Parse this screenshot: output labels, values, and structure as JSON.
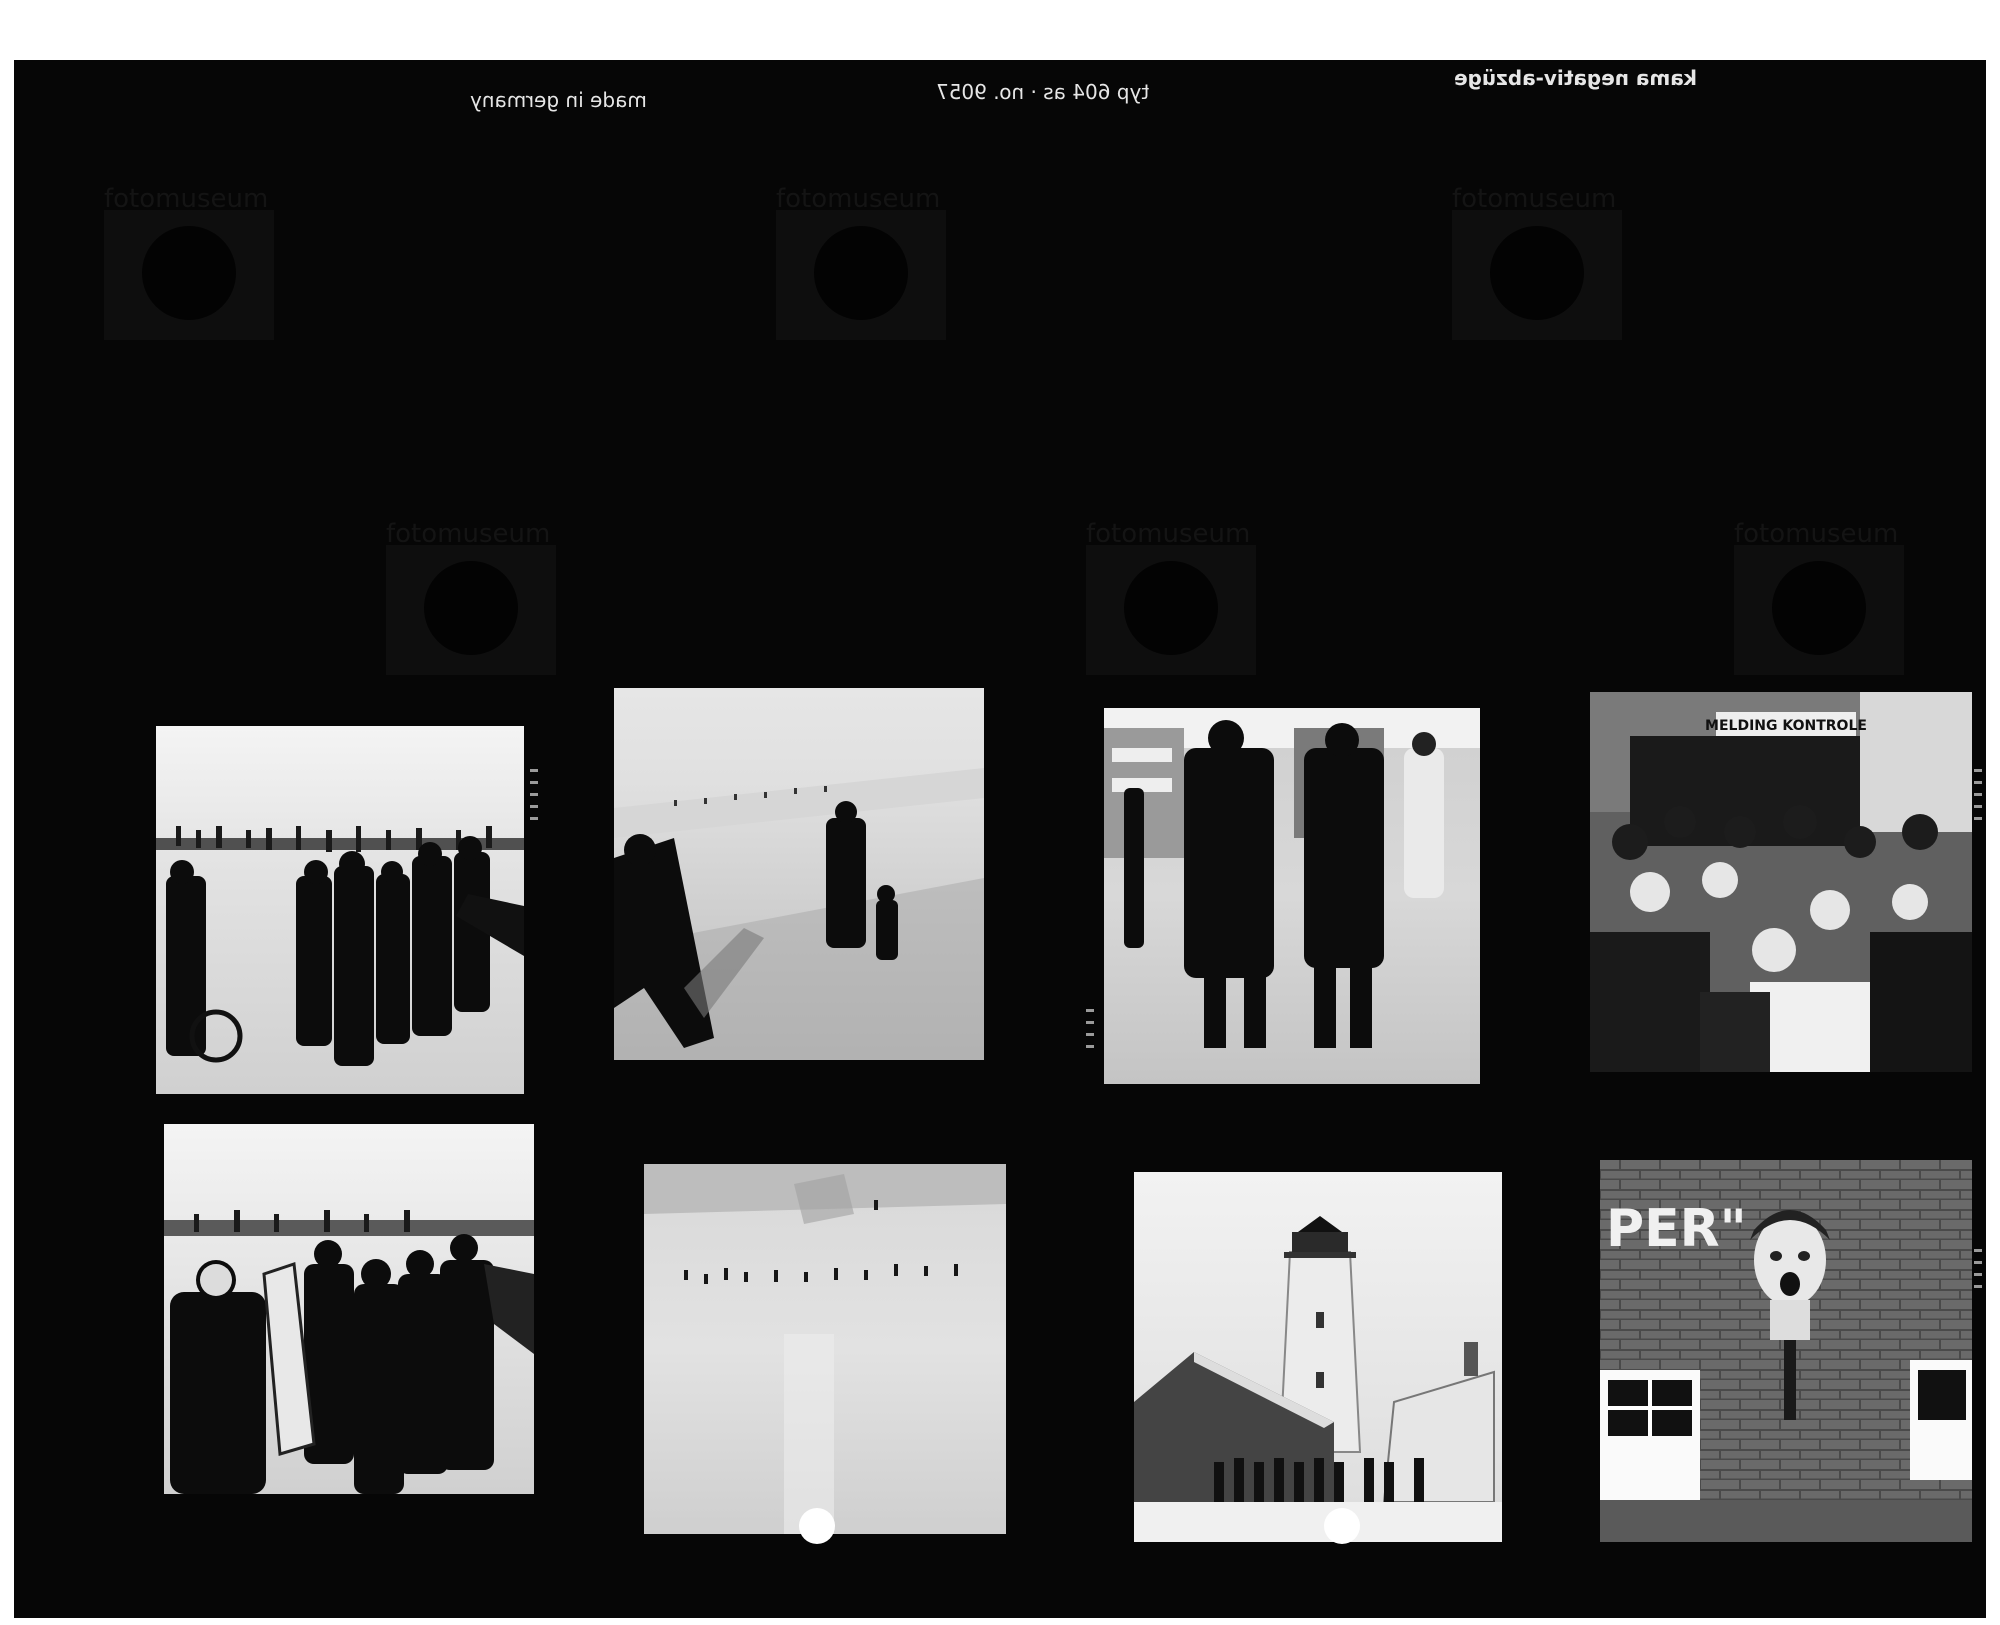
{
  "contact_sheet": {
    "edge_texts": [
      "made in germany",
      "typ 604 as · no. 9057",
      "kama negativ-abzüge"
    ],
    "watermark_text": "fotomuseum",
    "frames": [
      {
        "row": 1,
        "col": 1,
        "subject": "crowd-on-ice"
      },
      {
        "row": 1,
        "col": 2,
        "subject": "walkers-on-snowy-dike"
      },
      {
        "row": 1,
        "col": 3,
        "subject": "men-walking-in-snow"
      },
      {
        "row": 1,
        "col": 4,
        "subject": "crowd-at-melding-kontrole"
      },
      {
        "row": 2,
        "col": 1,
        "subject": "group-of-men-in-snow"
      },
      {
        "row": 2,
        "col": 2,
        "subject": "skaters-on-frozen-lake"
      },
      {
        "row": 2,
        "col": 3,
        "subject": "lighthouse"
      },
      {
        "row": 2,
        "col": 4,
        "subject": "brick-wall-with-mask"
      }
    ],
    "sign_text": "MELDING KONTROLE",
    "wall_text": "PER\""
  }
}
